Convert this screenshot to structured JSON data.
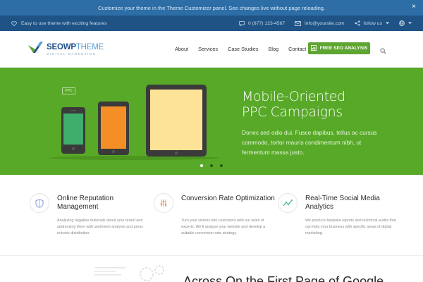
{
  "customizer": {
    "message": "Customize your theme in the Theme Customizer panel. See changes live without page reloading.",
    "close": "×"
  },
  "topbar": {
    "tagline": "Easy to use theme with exciting features",
    "phone": "0 (877) 123-4567",
    "email": "info@yoursite.com",
    "follow": "follow us"
  },
  "logo": {
    "name_seo": "SEO",
    "name_wp": "WP",
    "name_theme": "THEME",
    "sub": "DIGITAL MARKETING"
  },
  "nav": {
    "items": [
      "About",
      "Services",
      "Case Studies",
      "Blog",
      "Contact"
    ],
    "cta": "FREE SEO ANALYSIS"
  },
  "hero": {
    "badge": "PPC",
    "title_line1": "Mobile-Oriented",
    "title_line2": "PPC Campaigns",
    "text": "Donec sed odio dui. Fusce dapibus, tellus ac cursus commodo, tortor mauris condimentum nibh, ut fermentum massa justo.",
    "colors": {
      "background": "#57a927",
      "phone_screen": "#3fae6d",
      "tablet_screen": "#f48f25",
      "ipad_screen": "#fde397",
      "device": "#3a3a3a"
    }
  },
  "features": [
    {
      "icon": "shield-icon",
      "title": "Online Reputation Management",
      "text": "Analyzing negative materials about your brand and addressing them with sentiment analysis and press release distribution."
    },
    {
      "icon": "sliders-icon",
      "title": "Conversion Rate Optimization",
      "text": "Turn your visitors into customers with our team of experts. We'll analyze your website and develop a suitable conversion-rate strategy."
    },
    {
      "icon": "line-chart-icon",
      "title": "Real-Time Social Media Analytics",
      "text": "We produce bespoke reports and technical audits that can help your business with specific areas of digital marketing."
    }
  ],
  "bottom": {
    "heading": "Across On the First Page of Google"
  }
}
